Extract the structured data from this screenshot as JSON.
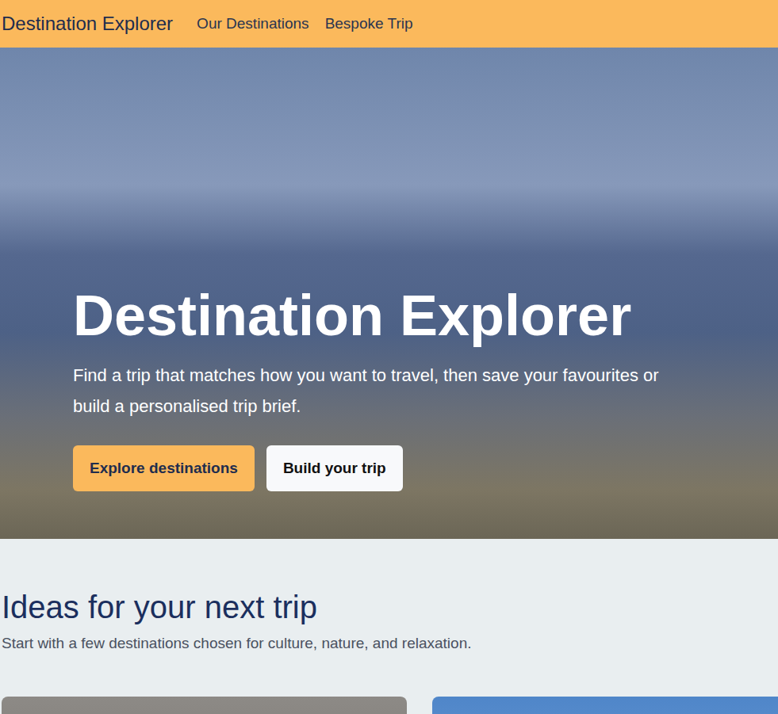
{
  "nav": {
    "brand": "Destination Explorer",
    "links": [
      "Our Destinations",
      "Bespoke Trip"
    ]
  },
  "hero": {
    "title": "Destination Explorer",
    "subtitle": "Find a trip that matches how you want to travel, then save your favourites or build a personalised trip brief.",
    "buttons": [
      {
        "label": "Explore destinations",
        "kind": "primary"
      },
      {
        "label": "Build your trip",
        "kind": "secondary"
      }
    ]
  },
  "section": {
    "title": "Ideas for your next trip",
    "subtitle": "Start with a few destinations chosen for culture, nature, and relaxation."
  }
}
